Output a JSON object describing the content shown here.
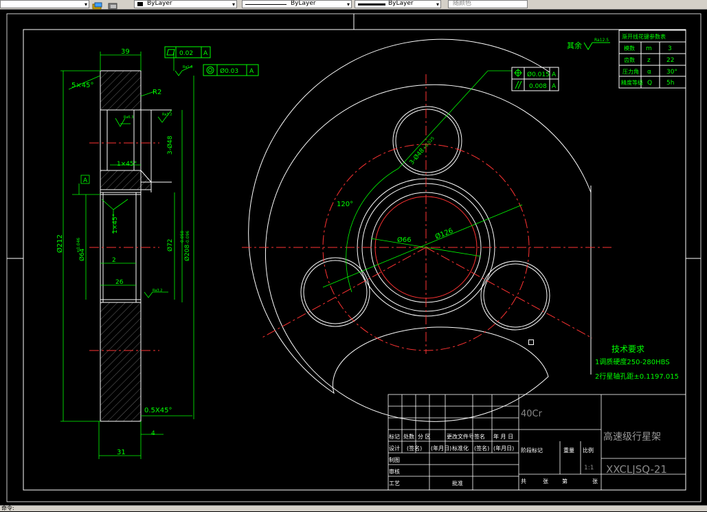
{
  "toolbar": {
    "linetype_label": "ByLayer",
    "lineweight_label": "ByLayer",
    "layer_color_label": "ByLayer",
    "plotstyle_label": "随颜色"
  },
  "drawing": {
    "dims": {
      "d39": "39",
      "flatness_tol": "0.02",
      "flatness_datum": "A",
      "coax_tol": "Ø0.03",
      "coax_datum": "A",
      "chamfer_top": "5×45°",
      "fillet": "R2",
      "holes_3": "3-Ø48",
      "chamfer_1x45": "1×45°",
      "datum_a": "A",
      "chamfer_1x45b": "1×45°",
      "bore_64": "Ø64",
      "bore_64_tol": "+0.046",
      "bore_72": "Ø72",
      "d212": "Ø212",
      "d208": "Ø208",
      "d208_tol_up": "-0.050",
      "d208_tol_dn": "-0.096",
      "d2": "2",
      "d26": "26",
      "chamfer_05": "0.5X45°",
      "d4": "4",
      "d31": "31",
      "rough_small": "Ra6.3",
      "rough_16": "Ra1.6",
      "rough_32": "Ra3.2",
      "pos_tol": "Ø0.015",
      "pos_datum": "A",
      "par_tol": "0.008",
      "par_datum": "A",
      "holes_right": "3-Ø48",
      "holes_right_tol": "+0.025",
      "angle_120": "120°",
      "d66": "Ø66",
      "d126": "Ø126",
      "rest_rough_label": "其余",
      "rest_rough_val": "Ra12.5"
    },
    "gear_table": {
      "title": "渐开线花键参数表",
      "rows": [
        [
          "模数",
          "m",
          "3"
        ],
        [
          "齿数",
          "z",
          "22"
        ],
        [
          "压力角",
          "α",
          "30°"
        ],
        [
          "精度等级",
          "Q",
          "5h"
        ]
      ]
    },
    "tech_req": {
      "title": "技术要求",
      "line1": "1调质硬度250-280HBS",
      "line2": "2行星轴孔距±0.1197.015"
    },
    "title_block": {
      "material": "40Cr",
      "part_name": "高速级行星架",
      "drawing_no": "XXCLJSQ-21",
      "scale": "1:1",
      "hdr_mark": "标记",
      "hdr_count": "处数",
      "hdr_zone": "分  区",
      "hdr_docno": "更改文件号",
      "hdr_sign": "签名",
      "hdr_date": "年 月 日",
      "design": "设计",
      "signed": "(签名)",
      "date": "(年月日)",
      "standard": "标准化",
      "signed2": "(签名)",
      "date2": "(年月日)",
      "stage": "阶段标记",
      "weight": "重量",
      "ratio": "比例",
      "draw": "制图",
      "review": "审核",
      "process": "工艺",
      "approve": "批准",
      "total": "共",
      "sheets": "张",
      "page": "第",
      "zhang": "张"
    }
  },
  "status": {
    "text": "命令:"
  }
}
